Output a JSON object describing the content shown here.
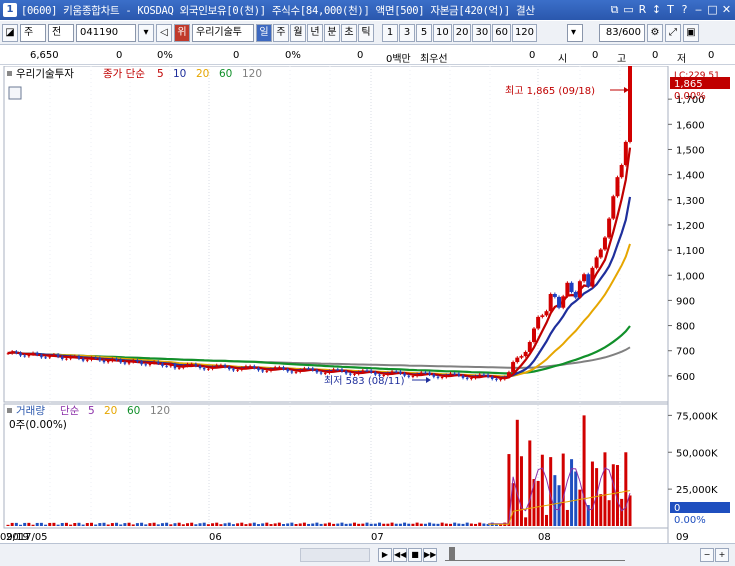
{
  "window": {
    "app_number": "1",
    "title": "[0600] 키움종합차트 - KOSDAQ 외국인보유[0(천)] 주식수[84,000(천)] 액면[500] 자본금[420(억)] 결산",
    "icons": [
      "copy-icon",
      "window-icon",
      "reserve-icon",
      "sort-icon",
      "text-icon",
      "help-icon",
      "minimize-icon",
      "maximize-icon",
      "close-icon"
    ],
    "icon_glyphs": [
      "⧉",
      "▭",
      "R",
      "↕",
      "T",
      "?",
      "‒",
      "□",
      "✕"
    ]
  },
  "toolbar": {
    "period_select": "주",
    "type_select": "전",
    "stock_code": "041190",
    "stock_name_button": "위",
    "stock_name": "우리기술투",
    "periods": [
      "일",
      "주",
      "월",
      "년",
      "분",
      "초",
      "틱"
    ],
    "active_period": "일",
    "intervals": [
      "1",
      "3",
      "5",
      "10",
      "20",
      "30",
      "60",
      "120"
    ],
    "page_counter": "83/600"
  },
  "info_row": {
    "price": "6,650",
    "change": "0",
    "change_pct": "0%",
    "volume": "0",
    "volume_pct": "0%",
    "amount": "0",
    "amount_unit": "0백만",
    "priority": "최우선",
    "priority_value": "0",
    "open_label": "시",
    "open_value": "0",
    "high_label": "고",
    "high_value": "0",
    "low_label": "저",
    "low_value": "0"
  },
  "price_legend": {
    "stock": "우리기술투자",
    "ma_type": "종가 단순",
    "ma_periods": [
      "5",
      "10",
      "20",
      "60",
      "120"
    ],
    "ma_colors": [
      "#c00000",
      "#1f2f9c",
      "#e6a600",
      "#11902a",
      "#808080"
    ]
  },
  "volume_legend": {
    "title": "거래량",
    "ma_type": "단순",
    "ma_periods": [
      "5",
      "20",
      "60",
      "120"
    ],
    "ma_colors": [
      "#8b2fa8",
      "#e6a600",
      "#11902a",
      "#808080"
    ],
    "current": "0주(0.00%)"
  },
  "annotations": {
    "high": "최고 1,865 (09/18)",
    "low": "최저 583 (08/11)",
    "last_price_box": "1,865",
    "last_pct_box": "0.00%",
    "lc_label": "LC:229.51",
    "vol_zero_box": "0",
    "vol_pct_box": "0.00%"
  },
  "chart_data": {
    "type": "candlestick",
    "price_axis": {
      "ticks": [
        600,
        700,
        800,
        900,
        1000,
        1100,
        1200,
        1300,
        1400,
        1500,
        1600,
        1700
      ],
      "labels": [
        "600",
        "700",
        "800",
        "900",
        "1,000",
        "1,100",
        "1,200",
        "1,300",
        "1,400",
        "1,500",
        "1,600",
        "1,700"
      ],
      "ylim": [
        520,
        1800
      ]
    },
    "volume_axis": {
      "ticks": [
        25000,
        50000,
        75000
      ],
      "labels": [
        "25,000K",
        "50,000K",
        "75,000K"
      ],
      "ylim": [
        0,
        80000
      ]
    },
    "x_labels": [
      "2017/05",
      "06",
      "07",
      "08",
      "09",
      "09/19"
    ],
    "series_names": [
      "종가",
      "5",
      "10",
      "20",
      "60",
      "120"
    ]
  },
  "bottom": {
    "date_axis_right": "09/19",
    "nav_buttons": [
      "▶",
      "◀◀",
      "■",
      "▶▶"
    ],
    "zoom_buttons": [
      "−",
      "+"
    ]
  }
}
